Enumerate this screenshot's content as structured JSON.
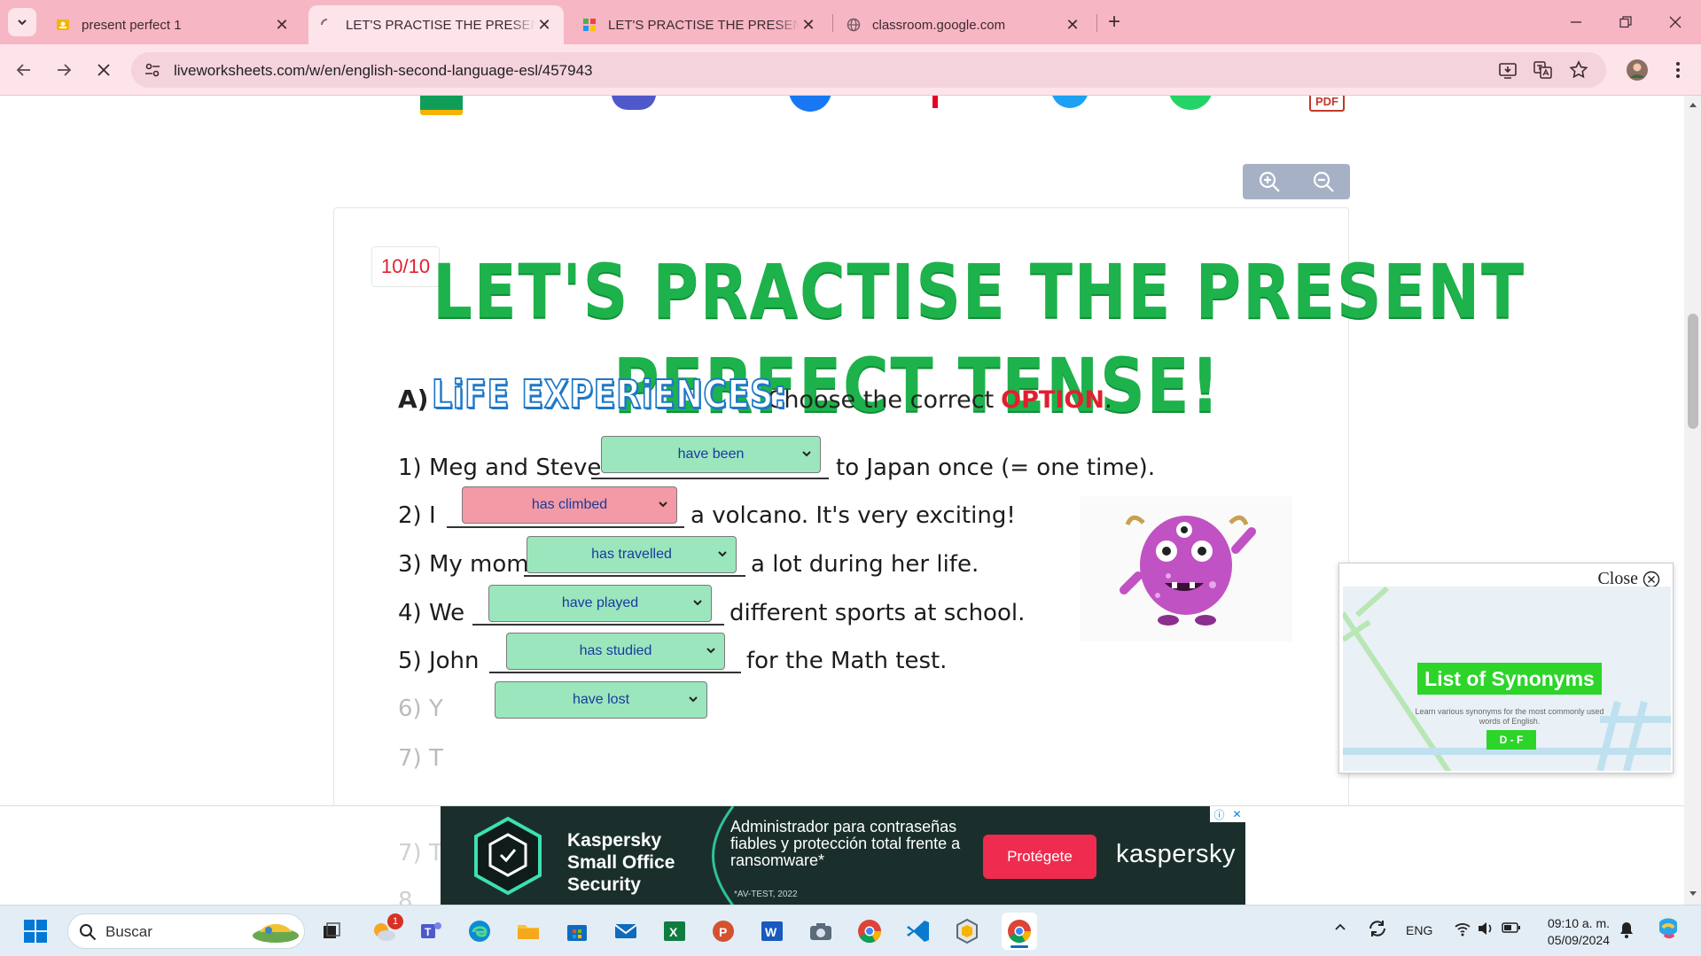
{
  "tabs": [
    {
      "title": "present perfect 1",
      "active": false
    },
    {
      "title": "LET'S PRACTISE THE PRESENT PERFECT TENSE!",
      "active": true
    },
    {
      "title": "LET'S PRACTISE THE PRESENT PERFECT TENSE!",
      "active": false
    },
    {
      "title": "classroom.google.com",
      "active": false
    }
  ],
  "toolbar": {
    "url": "liveworksheets.com/w/en/english-second-language-esl/457943"
  },
  "worksheet": {
    "score": "10/10",
    "title_line1": "LET'S PRACTISE THE PRESENT",
    "title_line2": "PERFECT TENSE!",
    "section_letter": "A)",
    "section_name": "LiFE EXPERiENCES:",
    "instruction_pre": "Choose the correct",
    "instruction_key": "OPTION",
    "instruction_post": ".",
    "questions": [
      {
        "before": "1) Meg and Steve",
        "after": "to Japan once (= one time).",
        "answer": "have been",
        "correct": true
      },
      {
        "before": "2) I",
        "after": "a volcano. It's very exciting!",
        "answer": "has climbed",
        "correct": false
      },
      {
        "before": "3) My mom",
        "after": "a lot during her life.",
        "answer": "has travelled",
        "correct": true
      },
      {
        "before": "4) We",
        "after": "different sports at school.",
        "answer": "have played",
        "correct": true
      },
      {
        "before": "5) John",
        "after": "for the Math test.",
        "answer": "has studied",
        "correct": true
      },
      {
        "before": "6) Y",
        "after": "",
        "answer": "have lost",
        "correct": true
      },
      {
        "before": "7) T",
        "after": "",
        "answer": "",
        "correct": true
      }
    ]
  },
  "popup": {
    "close_label": "Close",
    "ad_title": "List of Synonyms",
    "ad_desc": "Learn various synonyms for the most commonly used words of English.",
    "ad_range": "D - F"
  },
  "bottom_ad": {
    "brand_line1": "Kaspersky",
    "brand_line2": "Small Office",
    "brand_line3": "Security",
    "copy": "Administrador para contraseñas fiables y protección total frente a ransomware*",
    "footnote": "*AV-TEST, 2022",
    "button": "Protégete",
    "logo": "kaspersky"
  },
  "taskbar": {
    "search_placeholder": "Buscar",
    "mail_badge": "1",
    "language": "ENG",
    "time": "09:10 a. m.",
    "date": "05/09/2024"
  },
  "colors": {
    "tab_bar": "#f7b6c4",
    "toolbar": "#fce4ea",
    "title_green": "#1db24b",
    "correct": "#9be6bd",
    "wrong": "#f39aa6",
    "section_blue": "#1e78c8",
    "option_red": "#e0202f"
  }
}
